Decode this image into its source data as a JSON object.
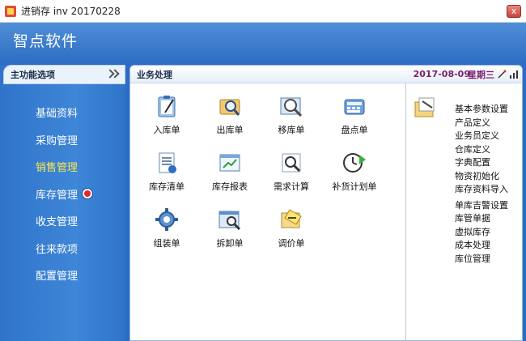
{
  "window": {
    "title": "进销存 inv 20170228",
    "close_label": "x"
  },
  "header": {
    "brand": "智点软件"
  },
  "sidebar": {
    "title": "主功能选项",
    "items": [
      {
        "label": "基础资料",
        "active": false
      },
      {
        "label": "采购管理",
        "active": false
      },
      {
        "label": "销售管理",
        "active": true
      },
      {
        "label": "库存管理",
        "active": false,
        "badge": true
      },
      {
        "label": "收支管理",
        "active": false
      },
      {
        "label": "往来款项",
        "active": false
      },
      {
        "label": "配置管理",
        "active": false
      }
    ]
  },
  "main": {
    "section_title": "业务处理",
    "date": "2017-08-09",
    "weekday": "星期三",
    "functions": [
      {
        "label": "入库单",
        "icon": "clipboard-pencil-icon"
      },
      {
        "label": "出库单",
        "icon": "magnifier-folder-icon"
      },
      {
        "label": "移库单",
        "icon": "magnifier-window-icon"
      },
      {
        "label": "盘点单",
        "icon": "calculator-icon"
      },
      {
        "label": "库存清单",
        "icon": "document-list-icon"
      },
      {
        "label": "库存报表",
        "icon": "report-window-icon"
      },
      {
        "label": "需求计算",
        "icon": "search-chart-icon"
      },
      {
        "label": "补货计划单",
        "icon": "clock-arrow-icon"
      },
      {
        "label": "组装单",
        "icon": "gear-icon"
      },
      {
        "label": "拆卸单",
        "icon": "window-zoom-icon"
      },
      {
        "label": "调价单",
        "icon": "tag-folder-icon"
      }
    ],
    "links": [
      "基本参数设置",
      "产品定义",
      "业务员定义",
      "仓库定义",
      "字典配置",
      "物资初始化",
      "库存资料导入",
      "单库吉警设置",
      "库管单据",
      "虚拟库存",
      "成本处理",
      "库位管理"
    ]
  },
  "colors": {
    "header_blue": "#2f6fc2",
    "active_menu": "#ffe94a",
    "date_purple": "#7a1f6e"
  }
}
